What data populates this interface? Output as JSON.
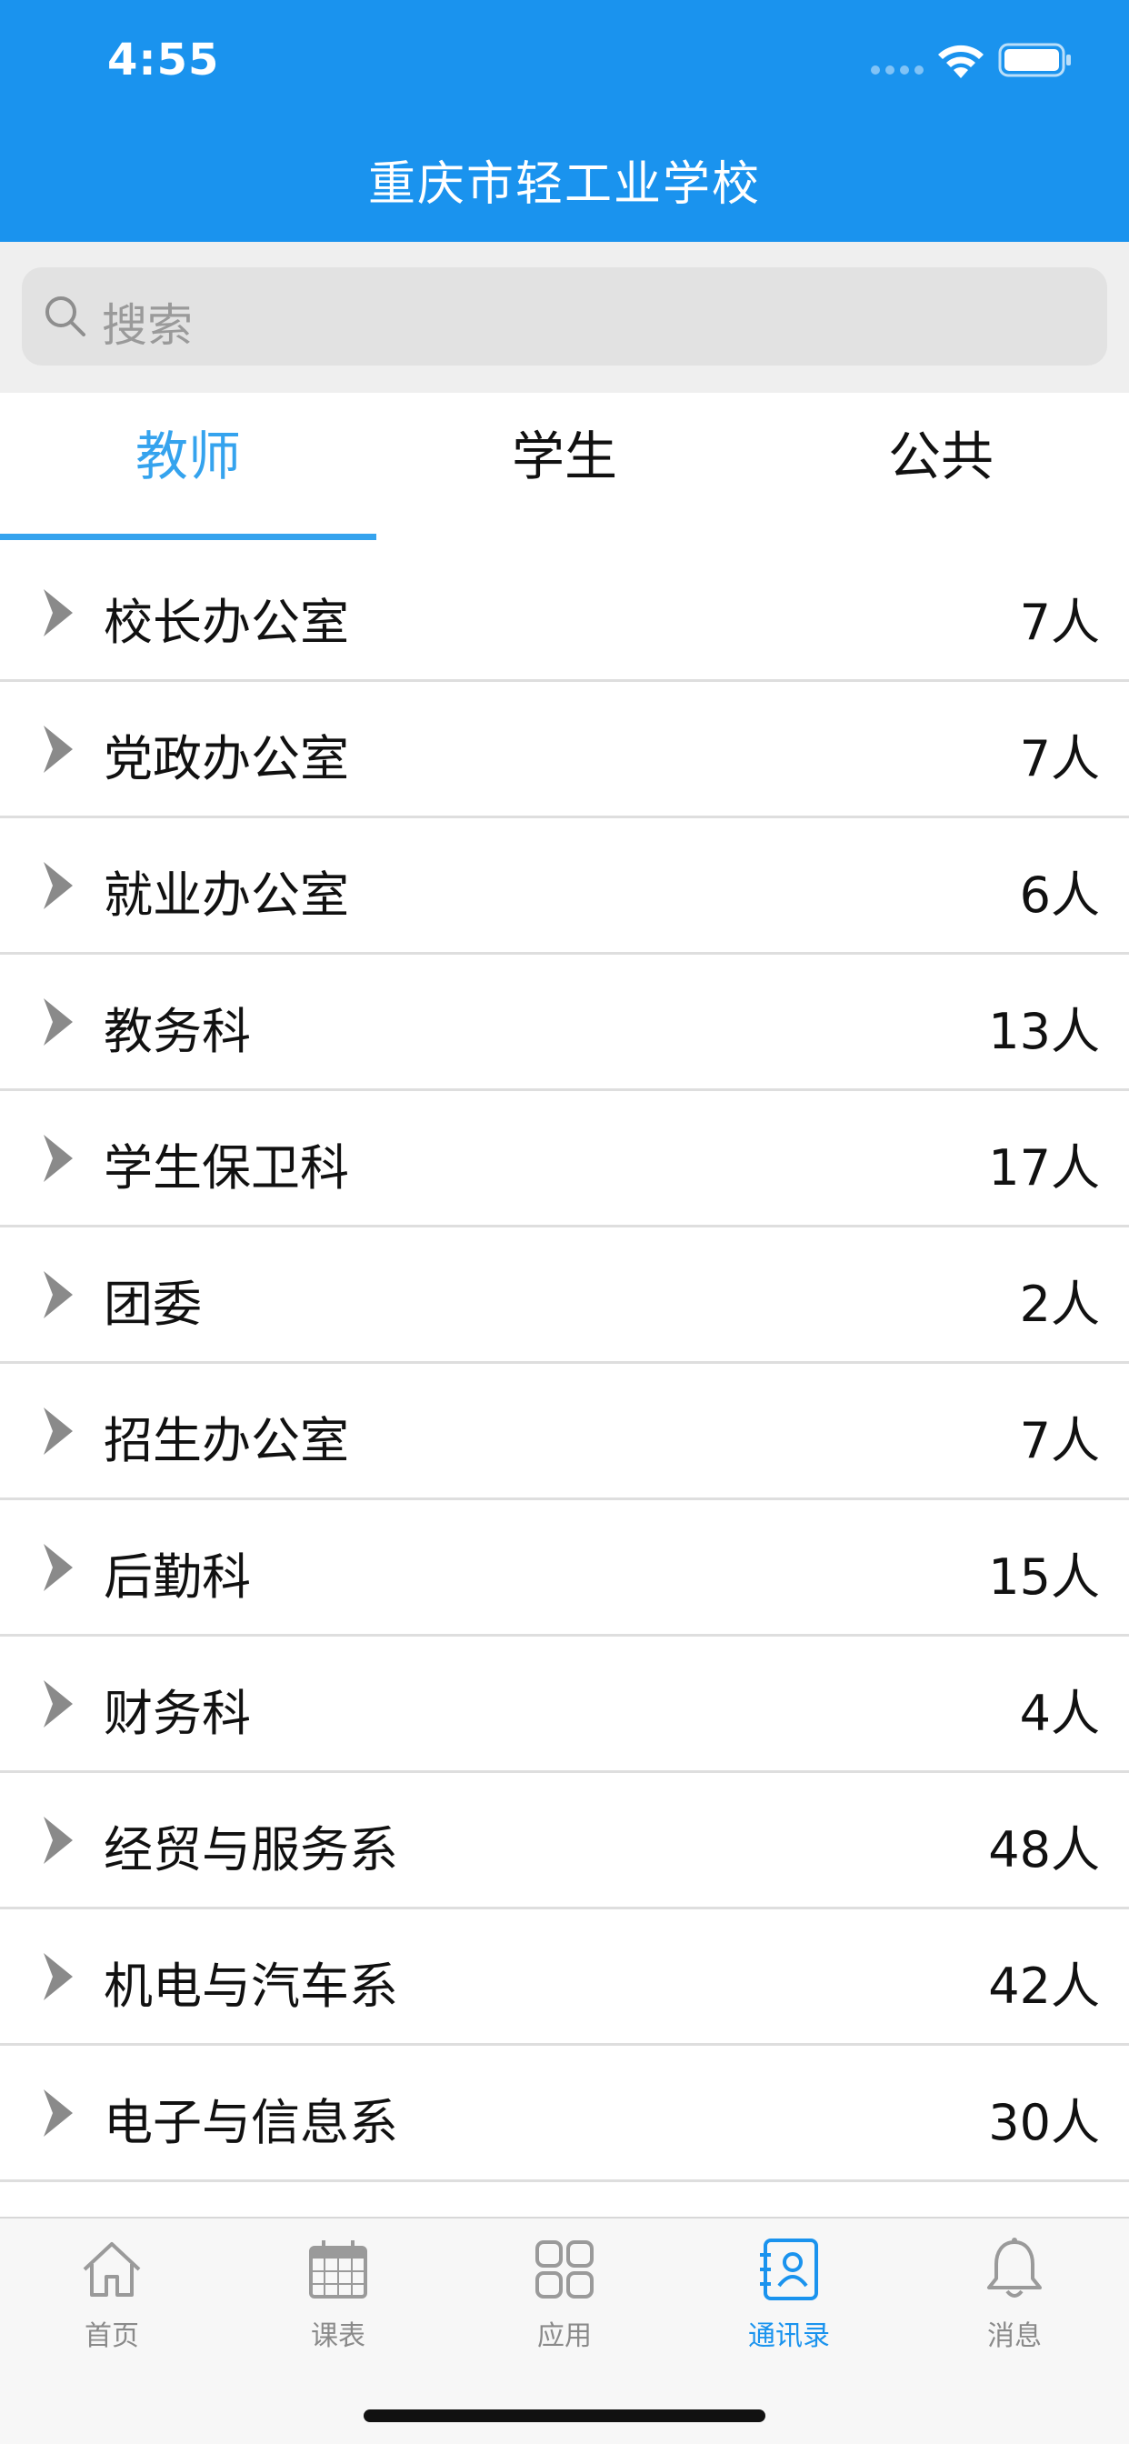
{
  "status": {
    "time": "4:55"
  },
  "nav": {
    "title": "重庆市轻工业学校"
  },
  "search": {
    "placeholder": "搜索"
  },
  "tabs": [
    {
      "label": "教师",
      "active": true
    },
    {
      "label": "学生",
      "active": false
    },
    {
      "label": "公共",
      "active": false
    }
  ],
  "departments": [
    {
      "name": "校长办公室",
      "count": "7人"
    },
    {
      "name": "党政办公室",
      "count": "7人"
    },
    {
      "name": "就业办公室",
      "count": "6人"
    },
    {
      "name": "教务科",
      "count": "13人"
    },
    {
      "name": "学生保卫科",
      "count": "17人"
    },
    {
      "name": "团委",
      "count": "2人"
    },
    {
      "name": "招生办公室",
      "count": "7人"
    },
    {
      "name": "后勤科",
      "count": "15人"
    },
    {
      "name": "财务科",
      "count": "4人"
    },
    {
      "name": "经贸与服务系",
      "count": "48人"
    },
    {
      "name": "机电与汽车系",
      "count": "42人"
    },
    {
      "name": "电子与信息系",
      "count": "30人"
    }
  ],
  "tabbar": [
    {
      "label": "首页",
      "icon": "home-icon",
      "active": false
    },
    {
      "label": "课表",
      "icon": "calendar-icon",
      "active": false
    },
    {
      "label": "应用",
      "icon": "apps-grid-icon",
      "active": false
    },
    {
      "label": "通讯录",
      "icon": "contacts-icon",
      "active": true
    },
    {
      "label": "消息",
      "icon": "bell-icon",
      "active": false
    }
  ],
  "colors": {
    "brand": "#1a93ee",
    "tab_active": "#35a3ee"
  }
}
